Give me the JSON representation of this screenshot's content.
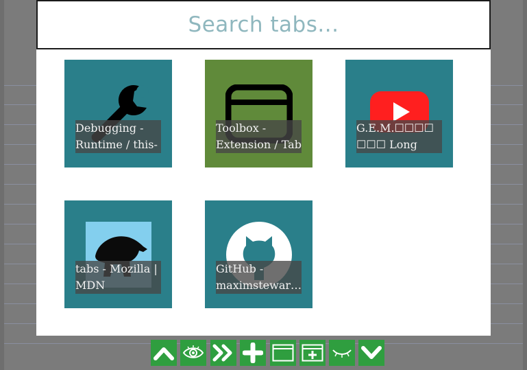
{
  "search": {
    "placeholder": "Search tabs..."
  },
  "tabs": [
    {
      "title": "Debugging - Runtime / this-",
      "icon": "wrench-icon"
    },
    {
      "title": "Toolbox - Extension / Tab",
      "icon": "browser-window-icon"
    },
    {
      "title": "G.E.M.☐☐☐☐ ☐☐☐ Long",
      "icon": "youtube-icon"
    },
    {
      "title": "tabs - Mozilla | MDN",
      "icon": "mdn-dinosaur-icon"
    },
    {
      "title": "GitHub - maximstewar…",
      "icon": "github-icon"
    }
  ],
  "toolbar": [
    {
      "name": "move-up-button",
      "icon": "chevron-up-icon"
    },
    {
      "name": "preview-button",
      "icon": "eye-icon"
    },
    {
      "name": "go-to-tab-button",
      "icon": "double-chevron-right-icon"
    },
    {
      "name": "new-tab-button",
      "icon": "plus-icon"
    },
    {
      "name": "new-window-button",
      "icon": "window-icon"
    },
    {
      "name": "new-tab-in-window-button",
      "icon": "window-plus-icon"
    },
    {
      "name": "hide-button",
      "icon": "closed-eye-icon"
    },
    {
      "name": "move-down-button",
      "icon": "chevron-down-icon"
    }
  ],
  "colors": {
    "tile": "#2a7f8a",
    "tile_alt": "#608a3a",
    "toolbar": "#2f9e3f",
    "search_text": "#8fb7be"
  }
}
